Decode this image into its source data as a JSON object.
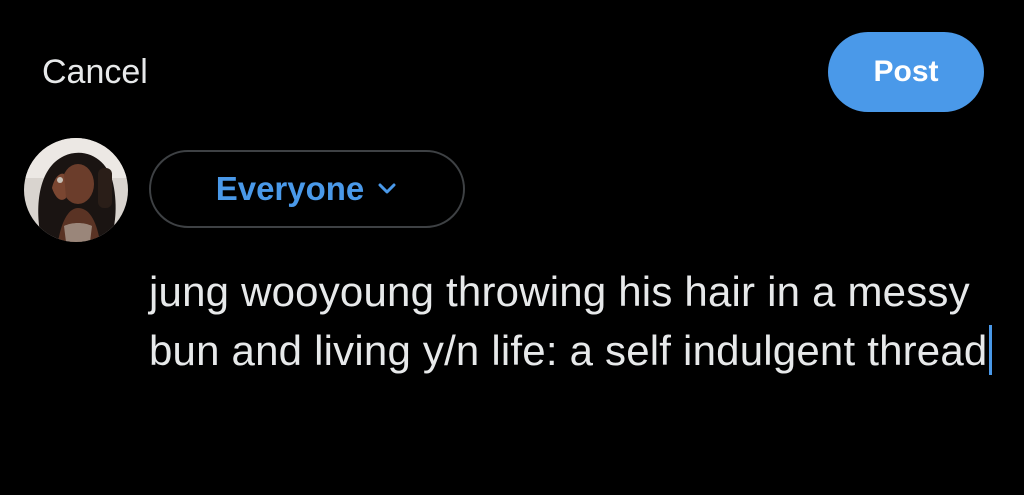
{
  "header": {
    "cancel_label": "Cancel",
    "post_label": "Post"
  },
  "audience": {
    "label": "Everyone",
    "icon": "chevron-down-icon"
  },
  "composer": {
    "text": "jung wooyoung throwing his hair in a messy bun and living y/n life: a self indulgent thread"
  },
  "colors": {
    "background": "#000000",
    "accent": "#4a99e9",
    "text": "#e7e9ea",
    "border": "#3e4144"
  }
}
